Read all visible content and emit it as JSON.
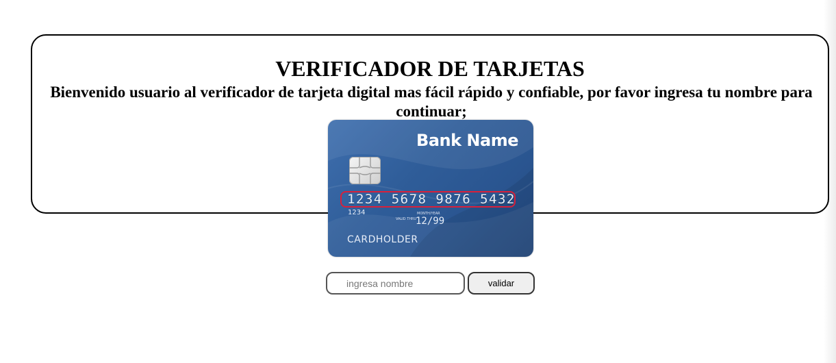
{
  "header": {
    "title": "VERIFICADOR DE TARJETAS",
    "subtitle": "Bienvenido usuario al verificador de tarjeta digital mas fácil rápido y confiable, por favor ingresa tu nombre para continuar;"
  },
  "card": {
    "bank_name": "Bank Name",
    "number": "1234 5678 9876 5432",
    "number_small": "1234",
    "valid_thru": "VALID THRU",
    "month_year_label": "MONTH/YEAR",
    "expiry": "12/99",
    "cardholder": "CARDHOLDER",
    "colors": {
      "card_blue": "#2f5d99",
      "highlight_red": "#d8203a"
    }
  },
  "form": {
    "name_input": {
      "value": "",
      "placeholder": "ingresa nombre"
    },
    "validate_label": "validar"
  }
}
